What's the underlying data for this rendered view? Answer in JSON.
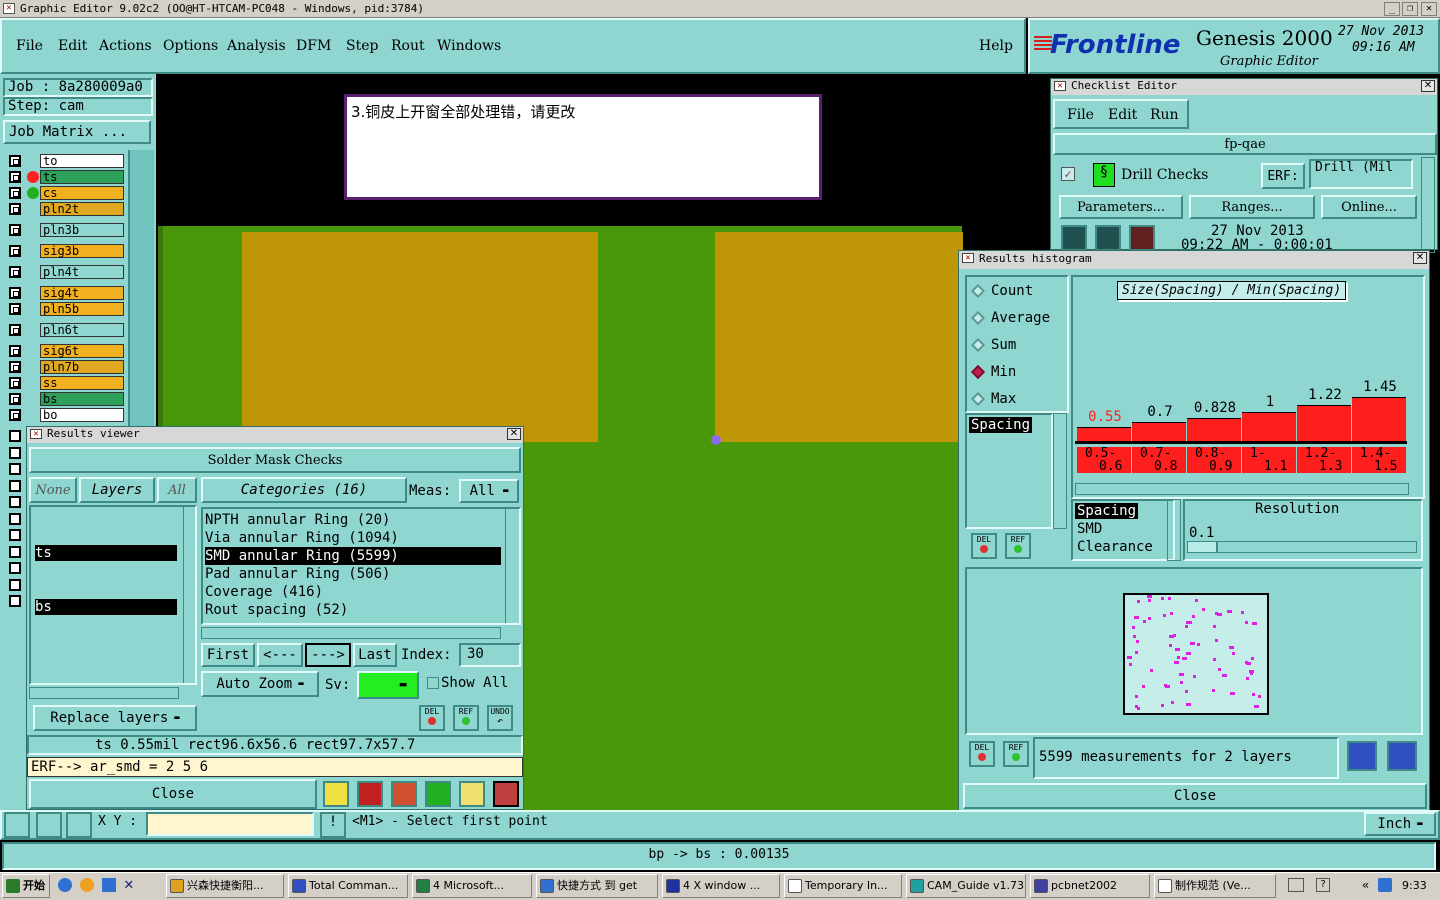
{
  "titlebar": {
    "text": "Graphic Editor 9.02c2  (OO@HT-HTCAM-PC048 - Windows, pid:3784)"
  },
  "menu": [
    "File",
    "Edit",
    "Actions",
    "Options",
    "Analysis",
    "DFM",
    "Step",
    "Rout",
    "Windows"
  ],
  "help": "Help",
  "brand": {
    "logo": "Frontline",
    "product": "Genesis 2000",
    "sub": "Graphic Editor",
    "date": "27 Nov 2013",
    "time": "09:16 AM"
  },
  "job": {
    "job": "Job : 8a280009a0",
    "step": "Step: cam",
    "matrix": "Job Matrix ..."
  },
  "layers": [
    {
      "name": "to",
      "color": "#ffffff"
    },
    {
      "name": "ts",
      "color": "#2fa05a"
    },
    {
      "name": "cs",
      "color": "#f0b020"
    },
    {
      "name": "pln2t",
      "color": "#e0a820"
    },
    {
      "name": "pln3b",
      "color": "#8fd6d1"
    },
    {
      "name": "sig3b",
      "color": "#f0b020"
    },
    {
      "name": "pln4t",
      "color": "#8fd6d1"
    },
    {
      "name": "sig4t",
      "color": "#f0b020"
    },
    {
      "name": "pln5b",
      "color": "#f0b020"
    },
    {
      "name": "pln6t",
      "color": "#8fd6d1"
    },
    {
      "name": "sig6t",
      "color": "#f0b020"
    },
    {
      "name": "pln7b",
      "color": "#e0a820"
    },
    {
      "name": "ss",
      "color": "#f0b020"
    },
    {
      "name": "bs",
      "color": "#2fa05a"
    },
    {
      "name": "bo",
      "color": "#ffffff"
    }
  ],
  "note": "3.铜皮上开窗全部处理错，请更改",
  "results_viewer": {
    "title": "Results viewer",
    "header": "Solder Mask Checks",
    "none": "None",
    "layers_btn": "Layers",
    "all": "All",
    "categories": "Categories (16)",
    "meas_label": "Meas:",
    "meas_value": "All",
    "layer_list": [
      "ts",
      "bs"
    ],
    "category_list": [
      "NPTH annular Ring (20)",
      "Via annular Ring (1094)",
      "SMD annular Ring (5599)",
      "Pad annular Ring (506)",
      "Coverage (416)",
      "Rout spacing (52)"
    ],
    "first": "First",
    "prev": "<---",
    "next": "--->",
    "last": "Last",
    "index_label": "Index:",
    "index_value": "30",
    "auto_zoom": "Auto Zoom",
    "sv": "Sv:",
    "show_all": "Show All",
    "replace_layers": "Replace layers",
    "info": "ts 0.55mil  rect96.6x56.6  rect97.7x57.7",
    "erf": "ERF--> ar_smd = 2 5 6",
    "close": "Close"
  },
  "checklist": {
    "title": "Checklist Editor",
    "menu": [
      "File",
      "Edit",
      "Run"
    ],
    "name": "fp-qae",
    "check": "Drill Checks",
    "erf_label": "ERF:",
    "erf_value": "Drill (Mil",
    "params": "Parameters...",
    "ranges": "Ranges...",
    "online": "Online...",
    "date": "27 Nov 2013",
    "time": "09:22 AM - 0:00:01"
  },
  "histogram": {
    "title": "Results histogram",
    "modes": [
      "Count",
      "Average",
      "Sum",
      "Min",
      "Max"
    ],
    "selected_mode": "Min",
    "chart_title": "Size(Spacing) / Min(Spacing)",
    "measures": [
      "Spacing",
      "SMD",
      "Clearance"
    ],
    "measure_sel": "Spacing",
    "resolution_label": "Resolution",
    "resolution_value": "0.1",
    "summary": "5599 measurements for 2 layers",
    "close": "Close"
  },
  "chart_data": {
    "type": "bar",
    "title": "Size(Spacing) / Min(Spacing)",
    "categories": [
      "0.5-0.6",
      "0.7-0.8",
      "0.8-0.9",
      "1-1.1",
      "1.2-1.3",
      "1.4-1.5"
    ],
    "values": [
      0.55,
      0.7,
      0.828,
      1,
      1.22,
      1.45
    ],
    "labels": [
      "0.55",
      "0.7",
      "0.828",
      "1",
      "1.22",
      "1.45"
    ],
    "category_display": [
      [
        "0.5-",
        "0.6"
      ],
      [
        "0.7-",
        "0.8"
      ],
      [
        "0.8-",
        "0.9"
      ],
      [
        "1-",
        "1.1"
      ],
      [
        "1.2-",
        "1.3"
      ],
      [
        "1.4-",
        "1.5"
      ]
    ],
    "first_label_color": "#ff2020"
  },
  "status": {
    "xy": "X Y :",
    "prompt": "<M1> - Select first point",
    "units": "Inch",
    "bottom": "bp -> bs : 0.00135"
  },
  "taskbar": {
    "start": "开始",
    "items": [
      "兴森快捷衡阳...",
      "Total Comman...",
      "4 Microsoft...",
      "快捷方式 到 get",
      "4 X window ...",
      "Temporary In...",
      "CAM_Guide v1.73",
      "pcbnet2002",
      "制作规范 (Ve..."
    ],
    "time": "9:33"
  }
}
